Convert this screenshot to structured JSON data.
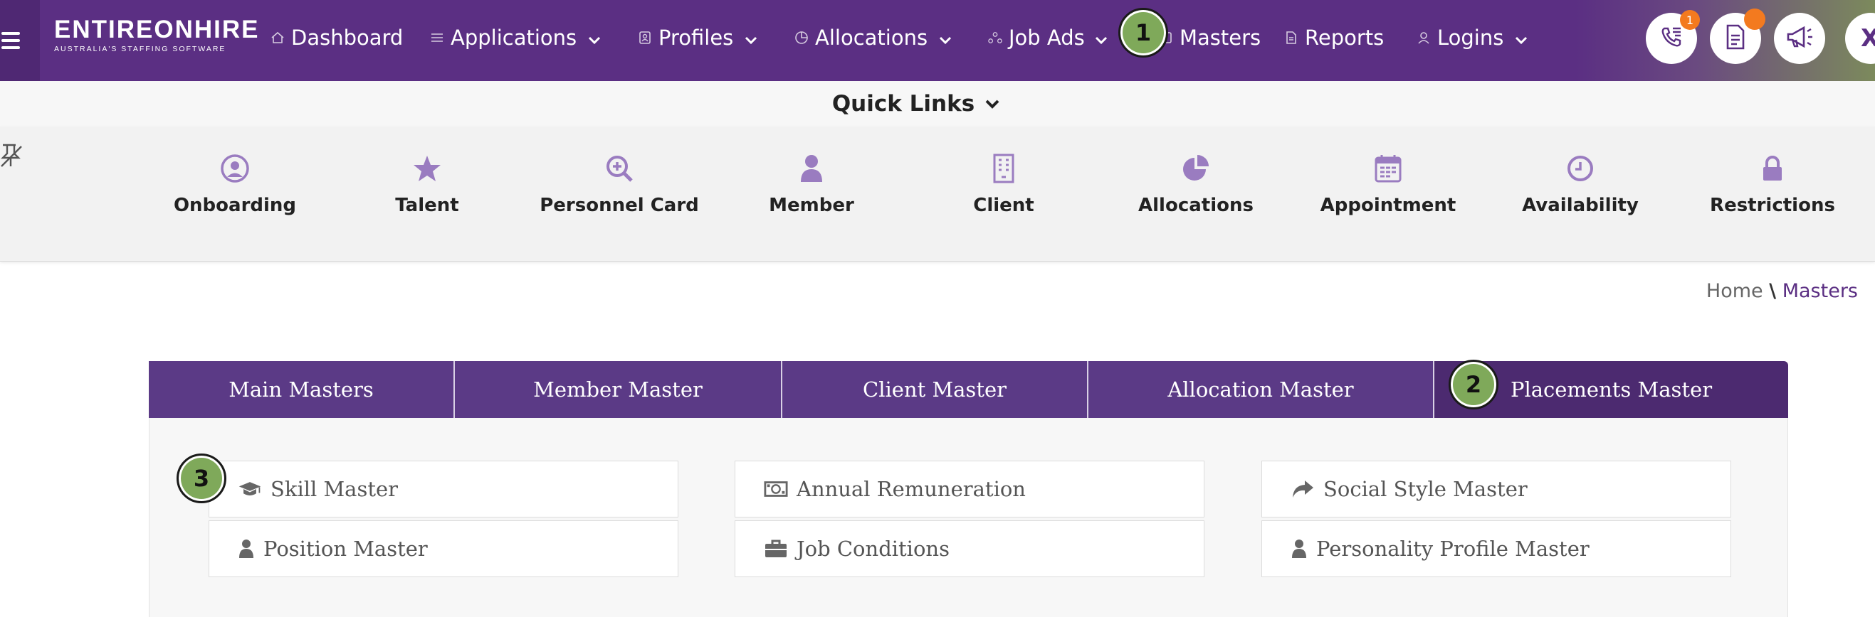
{
  "logo": {
    "main": "ENTIREONHIRE",
    "tagline": "AUSTRALIA'S STAFFING SOFTWARE"
  },
  "nav": {
    "items": [
      {
        "label": "Dashboard",
        "icon": "home-icon",
        "dropdown": false
      },
      {
        "label": "Applications",
        "icon": "list-icon",
        "dropdown": true
      },
      {
        "label": "Profiles",
        "icon": "profile-card-icon",
        "dropdown": true
      },
      {
        "label": "Allocations",
        "icon": "pie-chart-icon",
        "dropdown": true
      },
      {
        "label": "Job Ads",
        "icon": "network-icon",
        "dropdown": true
      },
      {
        "label": "Masters",
        "icon": "master-icon",
        "dropdown": false
      },
      {
        "label": "Reports",
        "icon": "document-icon",
        "dropdown": false
      },
      {
        "label": "Logins",
        "icon": "user-icon",
        "dropdown": true
      }
    ],
    "phone_badge": "1",
    "close_label": "X"
  },
  "quick_links": {
    "title": "Quick Links",
    "items": [
      {
        "label": "Onboarding",
        "icon": "user-circle-icon"
      },
      {
        "label": "Talent",
        "icon": "star-icon"
      },
      {
        "label": "Personnel Card",
        "icon": "search-plus-icon"
      },
      {
        "label": "Member",
        "icon": "user-icon"
      },
      {
        "label": "Client",
        "icon": "building-icon"
      },
      {
        "label": "Allocations",
        "icon": "pie-chart-icon"
      },
      {
        "label": "Appointment",
        "icon": "calendar-icon"
      },
      {
        "label": "Availability",
        "icon": "clock-icon"
      },
      {
        "label": "Restrictions",
        "icon": "lock-icon"
      }
    ]
  },
  "breadcrumb": {
    "home": "Home",
    "separator": "\\",
    "current": "Masters"
  },
  "tabs": [
    {
      "label": "Main Masters"
    },
    {
      "label": "Member Master"
    },
    {
      "label": "Client Master"
    },
    {
      "label": "Allocation Master"
    },
    {
      "label": "Placements Master",
      "active": true
    }
  ],
  "masters": [
    {
      "label": "Skill Master",
      "icon": "graduation-cap-icon"
    },
    {
      "label": "Annual Remuneration",
      "icon": "money-icon"
    },
    {
      "label": "Social Style Master",
      "icon": "share-arrow-icon"
    },
    {
      "label": "Position Master",
      "icon": "user-icon"
    },
    {
      "label": "Job Conditions",
      "icon": "briefcase-icon"
    },
    {
      "label": "Personality Profile Master",
      "icon": "user-icon"
    }
  ],
  "steps": [
    "1",
    "2",
    "3"
  ],
  "colors": {
    "primary": "#5b2f83",
    "tab": "#5b3a86",
    "icon": "#9a7cc0",
    "step": "#7fa95a",
    "badge": "#f37a1f"
  }
}
